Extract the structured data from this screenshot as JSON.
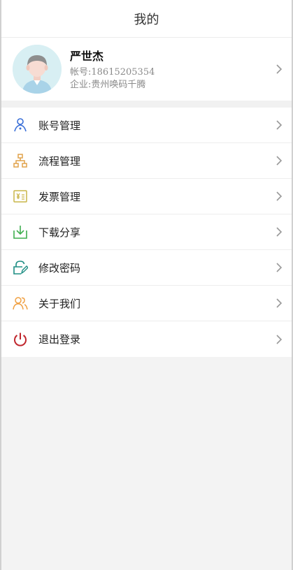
{
  "header": {
    "title": "我的"
  },
  "profile": {
    "name": "严世杰",
    "account": "帐号:18615205354",
    "company": "企业:贵州唤码千腾"
  },
  "menu": {
    "items": [
      {
        "label": "账号管理",
        "icon": "account-icon",
        "color": "#3a6fd8"
      },
      {
        "label": "流程管理",
        "icon": "flow-icon",
        "color": "#e0a24a"
      },
      {
        "label": "发票管理",
        "icon": "invoice-icon",
        "color": "#c9b548"
      },
      {
        "label": "下载分享",
        "icon": "download-icon",
        "color": "#3fae4f"
      },
      {
        "label": "修改密码",
        "icon": "edit-lock-icon",
        "color": "#1d8d83"
      },
      {
        "label": "关于我们",
        "icon": "about-users-icon",
        "color": "#f0a042"
      },
      {
        "label": "退出登录",
        "icon": "power-icon",
        "color": "#c0262d"
      }
    ]
  }
}
